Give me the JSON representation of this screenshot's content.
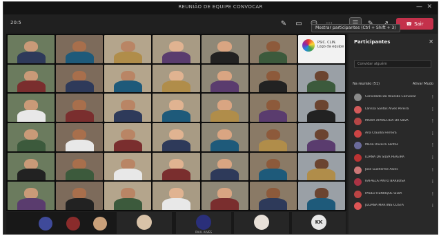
{
  "window": {
    "title": "REUNIÃO DE EQUIPE CONVOCAR",
    "minimize": "—",
    "close": "✕"
  },
  "toolbar": {
    "timer": "20:5",
    "leave_label": "Sair",
    "tooltip": "Mostrar participantes (Ctrl + Shift + 3)",
    "icons": [
      "participants-icon",
      "chat-icon",
      "reactions-icon",
      "more-icon",
      "camera-icon",
      "mic-icon",
      "share-icon"
    ]
  },
  "stage": {
    "logo_text": "PSIC. CLIN. Logo da equipe"
  },
  "strip": {
    "tiles": [
      {
        "name": "",
        "initials": ""
      },
      {
        "name": "",
        "initials": ""
      },
      {
        "name": "",
        "initials": ""
      },
      {
        "name": "",
        "initials": ""
      },
      {
        "name": "RAUL ALVES",
        "initials": ""
      },
      {
        "name": "",
        "initials": ""
      },
      {
        "name": "",
        "initials": "KK"
      }
    ]
  },
  "panel": {
    "title": "Participantes",
    "close": "✕",
    "invite_placeholder": "Convidar alguém",
    "in_meeting": "Na reunião (51)",
    "mute_all": "Ativar Mudo",
    "participants": [
      "Convidado Da Reunião Convocar",
      "Larissa Santos Alves Pereira",
      "MARIA APARECIDA DA SILVA",
      "Ana Claudia Ferreira",
      "Maria Oliveira Santos",
      "LUANA DA SILVA PEREIRA",
      "Jose Guilherme Alves",
      "RAFAELA PINTO BARBOSA",
      "PAULO HENRIQUE SILVA",
      "JULIANA MARTINS COSTA"
    ]
  }
}
